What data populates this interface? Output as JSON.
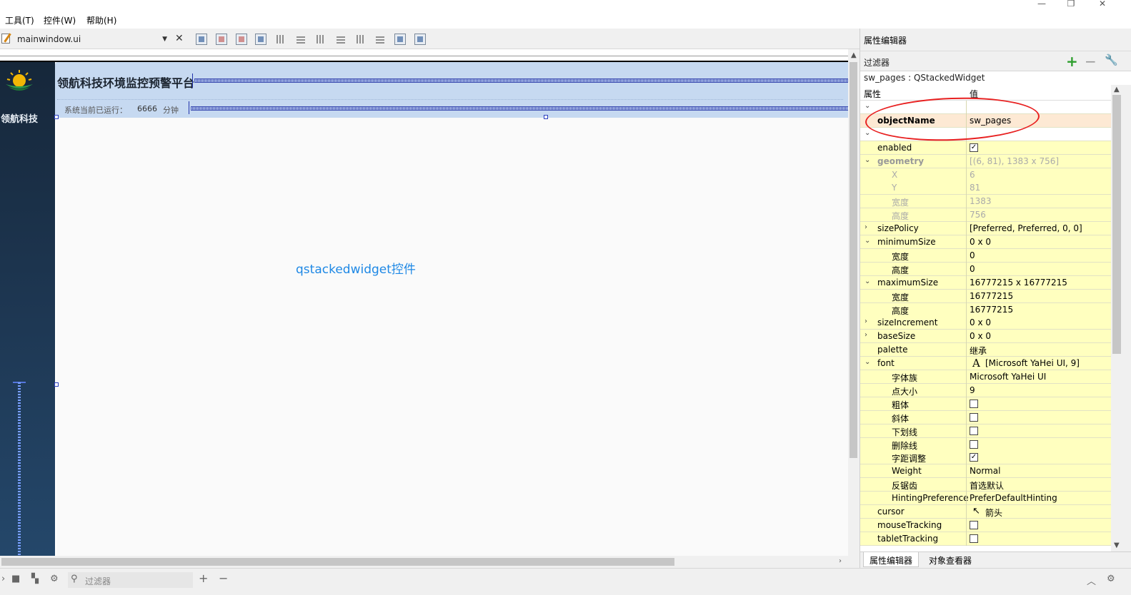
{
  "menu": [
    "工具(T)",
    "控件(W)",
    "帮助(H)"
  ],
  "document": {
    "filename": "mainwindow.ui"
  },
  "form": {
    "logo_text": "领航科技",
    "header_title": "领航科技环境监控预警平台",
    "runtime_label": "系统当前已运行：",
    "runtime_value": "6666",
    "runtime_unit": "分钟",
    "stacked_label": "qstackedwidget控件"
  },
  "bottombar": {
    "filter_placeholder": "过滤器"
  },
  "property_editor": {
    "title": "属性编辑器",
    "filter_label": "过滤器",
    "object_line": "sw_pages : QStackedWidget",
    "col_property": "属性",
    "col_value": "值",
    "rows": [
      {
        "name": "",
        "value": "",
        "expander": "v",
        "level": 0,
        "style": "sect"
      },
      {
        "name": "objectName",
        "value": "sw_pages",
        "level": 1,
        "style": "orange",
        "bold": true
      },
      {
        "name": "",
        "value": "",
        "expander": "v",
        "level": 0,
        "style": "sect"
      },
      {
        "name": "enabled",
        "checkbox": true,
        "checked": true,
        "level": 1,
        "style": "yellow"
      },
      {
        "name": "geometry",
        "value": "[(6, 81), 1383 x 756]",
        "expander": "v",
        "level": 1,
        "style": "yellow",
        "dim": true,
        "bold": true
      },
      {
        "name": "X",
        "value": "6",
        "level": 2,
        "style": "yellow",
        "dim": true
      },
      {
        "name": "Y",
        "value": "81",
        "level": 2,
        "style": "yellow",
        "dim": true
      },
      {
        "name": "宽度",
        "value": "1383",
        "level": 2,
        "style": "yellow",
        "dim": true
      },
      {
        "name": "高度",
        "value": "756",
        "level": 2,
        "style": "yellow",
        "dim": true
      },
      {
        "name": "sizePolicy",
        "value": "[Preferred, Preferred, 0, 0]",
        "expander": ">",
        "level": 1,
        "style": "yellow"
      },
      {
        "name": "minimumSize",
        "value": "0 x 0",
        "expander": "v",
        "level": 1,
        "style": "yellow"
      },
      {
        "name": "宽度",
        "value": "0",
        "level": 2,
        "style": "yellow"
      },
      {
        "name": "高度",
        "value": "0",
        "level": 2,
        "style": "yellow"
      },
      {
        "name": "maximumSize",
        "value": "16777215 x 16777215",
        "expander": "v",
        "level": 1,
        "style": "yellow"
      },
      {
        "name": "宽度",
        "value": "16777215",
        "level": 2,
        "style": "yellow"
      },
      {
        "name": "高度",
        "value": "16777215",
        "level": 2,
        "style": "yellow"
      },
      {
        "name": "sizeIncrement",
        "value": "0 x 0",
        "expander": ">",
        "level": 1,
        "style": "yellow"
      },
      {
        "name": "baseSize",
        "value": "0 x 0",
        "expander": ">",
        "level": 1,
        "style": "yellow"
      },
      {
        "name": "palette",
        "value": "继承",
        "level": 1,
        "style": "yellow"
      },
      {
        "name": "font",
        "value": "[Microsoft YaHei UI, 9]",
        "glyph": "A",
        "expander": "v",
        "level": 1,
        "style": "yellow"
      },
      {
        "name": "字体族",
        "value": "Microsoft YaHei UI",
        "level": 2,
        "style": "yellow"
      },
      {
        "name": "点大小",
        "value": "9",
        "level": 2,
        "style": "yellow"
      },
      {
        "name": "粗体",
        "checkbox": true,
        "checked": false,
        "level": 2,
        "style": "yellow"
      },
      {
        "name": "斜体",
        "checkbox": true,
        "checked": false,
        "level": 2,
        "style": "yellow"
      },
      {
        "name": "下划线",
        "checkbox": true,
        "checked": false,
        "level": 2,
        "style": "yellow"
      },
      {
        "name": "删除线",
        "checkbox": true,
        "checked": false,
        "level": 2,
        "style": "yellow"
      },
      {
        "name": "字距调整",
        "checkbox": true,
        "checked": true,
        "level": 2,
        "style": "yellow"
      },
      {
        "name": "Weight",
        "value": "Normal",
        "level": 2,
        "style": "yellow"
      },
      {
        "name": "反锯齿",
        "value": "首选默认",
        "level": 2,
        "style": "yellow"
      },
      {
        "name": "HintingPreference",
        "value": "PreferDefaultHinting",
        "level": 2,
        "style": "yellow"
      },
      {
        "name": "cursor",
        "value": "箭头",
        "glyph": "arrow",
        "level": 1,
        "style": "yellow"
      },
      {
        "name": "mouseTracking",
        "checkbox": true,
        "checked": false,
        "level": 1,
        "style": "yellow"
      },
      {
        "name": "tabletTracking",
        "checkbox": true,
        "checked": false,
        "level": 1,
        "style": "yellow"
      }
    ],
    "tabs": [
      "属性编辑器",
      "对象查看器"
    ]
  },
  "colors": {
    "accent_label": "#1e88e5",
    "highlight_circle": "#e82020",
    "row_yellow": "#ffffbf",
    "row_orange": "#fde9d4",
    "header_blue": "#c6d9f1"
  },
  "icons": [
    "plus-icon",
    "minus-icon",
    "wrench-icon",
    "gear-icon",
    "search-icon",
    "close-icon",
    "chevron-down-icon",
    "logo-icon",
    "font-icon",
    "cursor-icon"
  ]
}
